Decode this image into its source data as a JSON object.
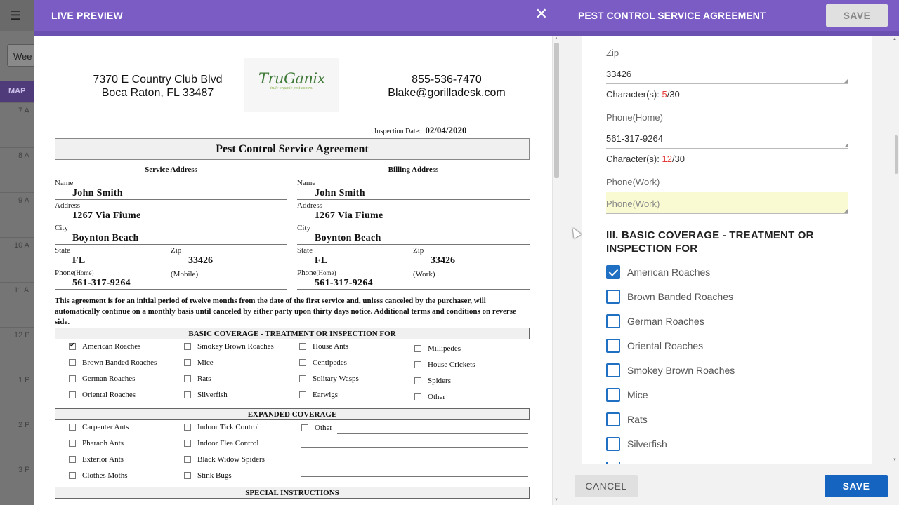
{
  "background": {
    "week_label": "Wee",
    "map_label": "MAP",
    "times": [
      "7 A",
      "8 A",
      "9 A",
      "10 A",
      "11 A",
      "12 P",
      "1 P",
      "2 P",
      "3 P"
    ]
  },
  "preview": {
    "title": "LIVE PREVIEW",
    "close_icon": "close-icon",
    "company_address_1": "7370 E Country Club Blvd",
    "company_address_2": "Boca Raton, FL 33487",
    "logo_name": "TruGanix",
    "logo_tagline": "truly organic pest control",
    "company_phone": "855-536-7470",
    "company_email": "Blake@gorilladesk.com",
    "inspection_label": "Inspection Date:",
    "inspection_date": "02/04/2020",
    "doc_title": "Pest Control Service Agreement",
    "service": {
      "heading": "Service Address",
      "name_label": "Name",
      "name": "John Smith",
      "address_label": "Address",
      "address": "1267 Via Fiume",
      "city_label": "City",
      "city": "Boynton Beach",
      "state_label": "State",
      "state": "FL",
      "zip_label": "Zip",
      "zip": "33426",
      "phone_label": "Phone",
      "phone_sub": "(Home)",
      "phone": "561-317-9264",
      "phone2_label": "(Mobile)"
    },
    "billing": {
      "heading": "Billing Address",
      "name_label": "Name",
      "name": "John Smith",
      "address_label": "Address",
      "address": "1267 Via Fiume",
      "city_label": "City",
      "city": "Boynton Beach",
      "state_label": "State",
      "state": "FL",
      "zip_label": "Zip",
      "zip": "33426",
      "phone_label": "Phone",
      "phone_sub": "(Home)",
      "phone": "561-317-9264",
      "phone2_label": "(Work)"
    },
    "terms": "This agreement is for an initial period of twelve months from the date of the first service and, unless canceled by the purchaser, will automatically continue on a monthly basis until canceled by either party upon thirty days notice. Additional terms and conditions on reverse side.",
    "basic_heading": "BASIC COVERAGE - TREATMENT OR INSPECTION FOR",
    "basic_items": [
      "American Roaches",
      "Brown Banded Roaches",
      "German Roaches",
      "Oriental Roaches",
      "Smokey Brown Roaches",
      "Mice",
      "Rats",
      "Silverfish",
      "House Ants",
      "Centipedes",
      "Solitary Wasps",
      "Earwigs",
      "Millipedes",
      "House Crickets",
      "Spiders",
      "Other"
    ],
    "expanded_heading": "EXPANDED COVERAGE",
    "expanded_items": [
      "Carpenter Ants",
      "Pharaoh Ants",
      "Exterior Ants",
      "Clothes Moths",
      "Indoor Tick Control",
      "Indoor Flea Control",
      "Black Widow Spiders",
      "Stink Bugs",
      "Other"
    ],
    "special_heading": "SPECIAL INSTRUCTIONS"
  },
  "form": {
    "title": "PEST CONTROL SERVICE AGREEMENT",
    "save_top": "SAVE",
    "zip_label": "Zip",
    "zip_value": "33426",
    "zip_chars_prefix": "Character(s): ",
    "zip_chars_count": "5",
    "zip_chars_max": "/30",
    "phone_home_label": "Phone(Home)",
    "phone_home_value": "561-317-9264",
    "phone_chars_prefix": "Character(s): ",
    "phone_chars_count": "12",
    "phone_chars_max": "/30",
    "phone_work_label": "Phone(Work)",
    "phone_work_placeholder": "Phone(Work)",
    "section_heading": "III. BASIC COVERAGE - TREATMENT OR INSPECTION FOR",
    "checkboxes": [
      {
        "label": "American Roaches",
        "checked": true
      },
      {
        "label": "Brown Banded Roaches",
        "checked": false
      },
      {
        "label": "German Roaches",
        "checked": false
      },
      {
        "label": "Oriental Roaches",
        "checked": false
      },
      {
        "label": "Smokey Brown Roaches",
        "checked": false
      },
      {
        "label": "Mice",
        "checked": false
      },
      {
        "label": "Rats",
        "checked": false
      },
      {
        "label": "Silverfish",
        "checked": false
      }
    ],
    "cancel": "CANCEL",
    "save": "SAVE"
  },
  "colors": {
    "header": "#7a5cc4",
    "primary": "#1565c0",
    "error_count": "#e53935"
  }
}
